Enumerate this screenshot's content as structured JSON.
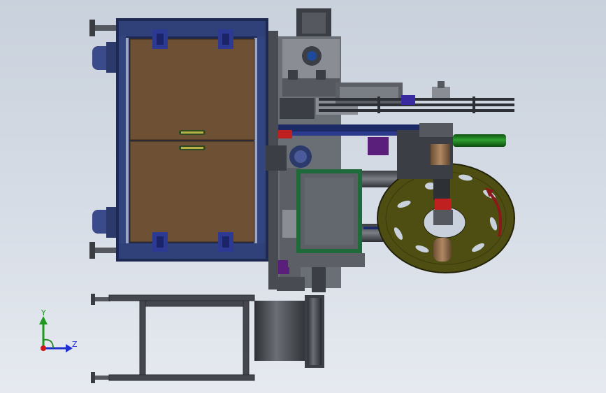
{
  "viewport": {
    "background_top": "#c9d1dc",
    "background_bottom": "#e6eaf0"
  },
  "triad": {
    "y_label": "Y",
    "z_label": "Z",
    "y_color": "#1f9a1f",
    "z_color": "#2030d0",
    "origin_color": "#d01818"
  },
  "model": {
    "frame_color": "#2b3a6b",
    "panel_color": "#6e5034",
    "steel_color": "#5c6066",
    "dark_steel_color": "#3b3e44",
    "wheel_color": "#4e4e12",
    "green_rod_color": "#1d7a1d",
    "purple_part_color": "#5a1f7a",
    "tan_roll_color": "#9a7350"
  }
}
